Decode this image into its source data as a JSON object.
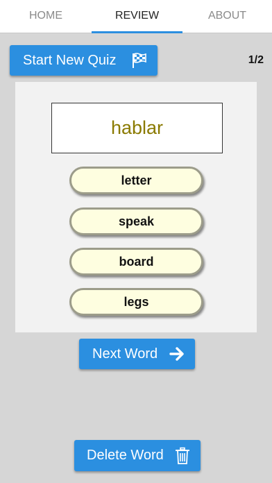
{
  "tabs": [
    {
      "label": "HOME"
    },
    {
      "label": "REVIEW"
    },
    {
      "label": "ABOUT"
    }
  ],
  "quiz": {
    "start_label": "Start New Quiz",
    "start_icon": "checkered-flag-icon",
    "counter": "1/2",
    "word": "hablar",
    "choices": [
      "letter",
      "speak",
      "board",
      "legs"
    ]
  },
  "next_label": "Next Word",
  "next_icon": "arrow-right-icon",
  "delete_label": "Delete Word",
  "delete_icon": "trash-icon",
  "colors": {
    "accent": "#2b8fe0",
    "word": "#8a7a00",
    "choice_bg": "#fefee0",
    "background": "#d6d6d6"
  }
}
